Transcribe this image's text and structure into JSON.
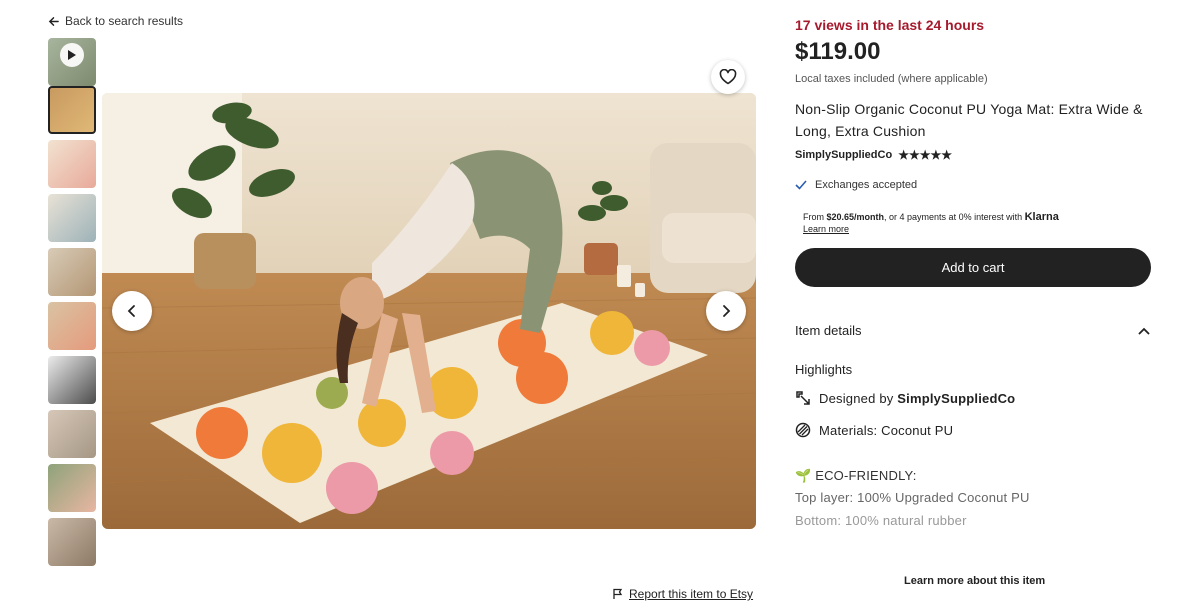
{
  "nav": {
    "back_label": "Back to search results"
  },
  "gallery": {
    "thumbnails": [
      {
        "kind": "video",
        "colors": [
          "#a8b59e",
          "#7d8a6e"
        ]
      },
      {
        "kind": "image",
        "selected": true,
        "colors": [
          "#c89a60",
          "#e0b876"
        ]
      },
      {
        "kind": "image",
        "colors": [
          "#f2e2d0",
          "#e8a99a"
        ]
      },
      {
        "kind": "image",
        "colors": [
          "#e8e2d6",
          "#9db2b8"
        ]
      },
      {
        "kind": "image",
        "colors": [
          "#d8cbb7",
          "#b39674"
        ]
      },
      {
        "kind": "image",
        "colors": [
          "#d9c3a3",
          "#e59a7c"
        ]
      },
      {
        "kind": "image",
        "colors": [
          "#ececec",
          "#4c4c4c"
        ]
      },
      {
        "kind": "image",
        "colors": [
          "#d6c7b8",
          "#a59784"
        ]
      },
      {
        "kind": "image",
        "colors": [
          "#8ea37a",
          "#e8b6a2"
        ]
      },
      {
        "kind": "image",
        "colors": [
          "#cbb9a8",
          "#8c7a66"
        ]
      }
    ],
    "report_label": "Report this item to Etsy"
  },
  "listing": {
    "views": "17 views in the last 24 hours",
    "price": "$119.00",
    "taxes": "Local taxes included (where applicable)",
    "title": "Non-Slip Organic Coconut PU Yoga Mat: Extra Wide & Long, Extra Cushion",
    "seller": "SimplySuppliedCo",
    "stars": "★★★★★",
    "exchanges": "Exchanges accepted"
  },
  "klarna": {
    "prefix": "From ",
    "amount": "$20.65/month",
    "suffix": ", or 4 payments at 0% interest with ",
    "brand": "Klarna",
    "learn_more": "Learn more"
  },
  "cart": {
    "label": "Add to cart"
  },
  "details": {
    "header": "Item details",
    "highlights_label": "Highlights",
    "designed_by_prefix": "Designed by ",
    "designed_by": "SimplySuppliedCo",
    "materials": "Materials: Coconut PU",
    "eco_label": "ECO-FRIENDLY:",
    "top_layer": "Top layer: 100% Upgraded Coconut PU",
    "bottom_layer": "Bottom: 100% natural rubber",
    "learn_more_label": "Learn more about this item"
  },
  "colors": {
    "views_red": "#a61a2e",
    "button_dark": "#222222",
    "check_blue": "#2a5db0"
  }
}
